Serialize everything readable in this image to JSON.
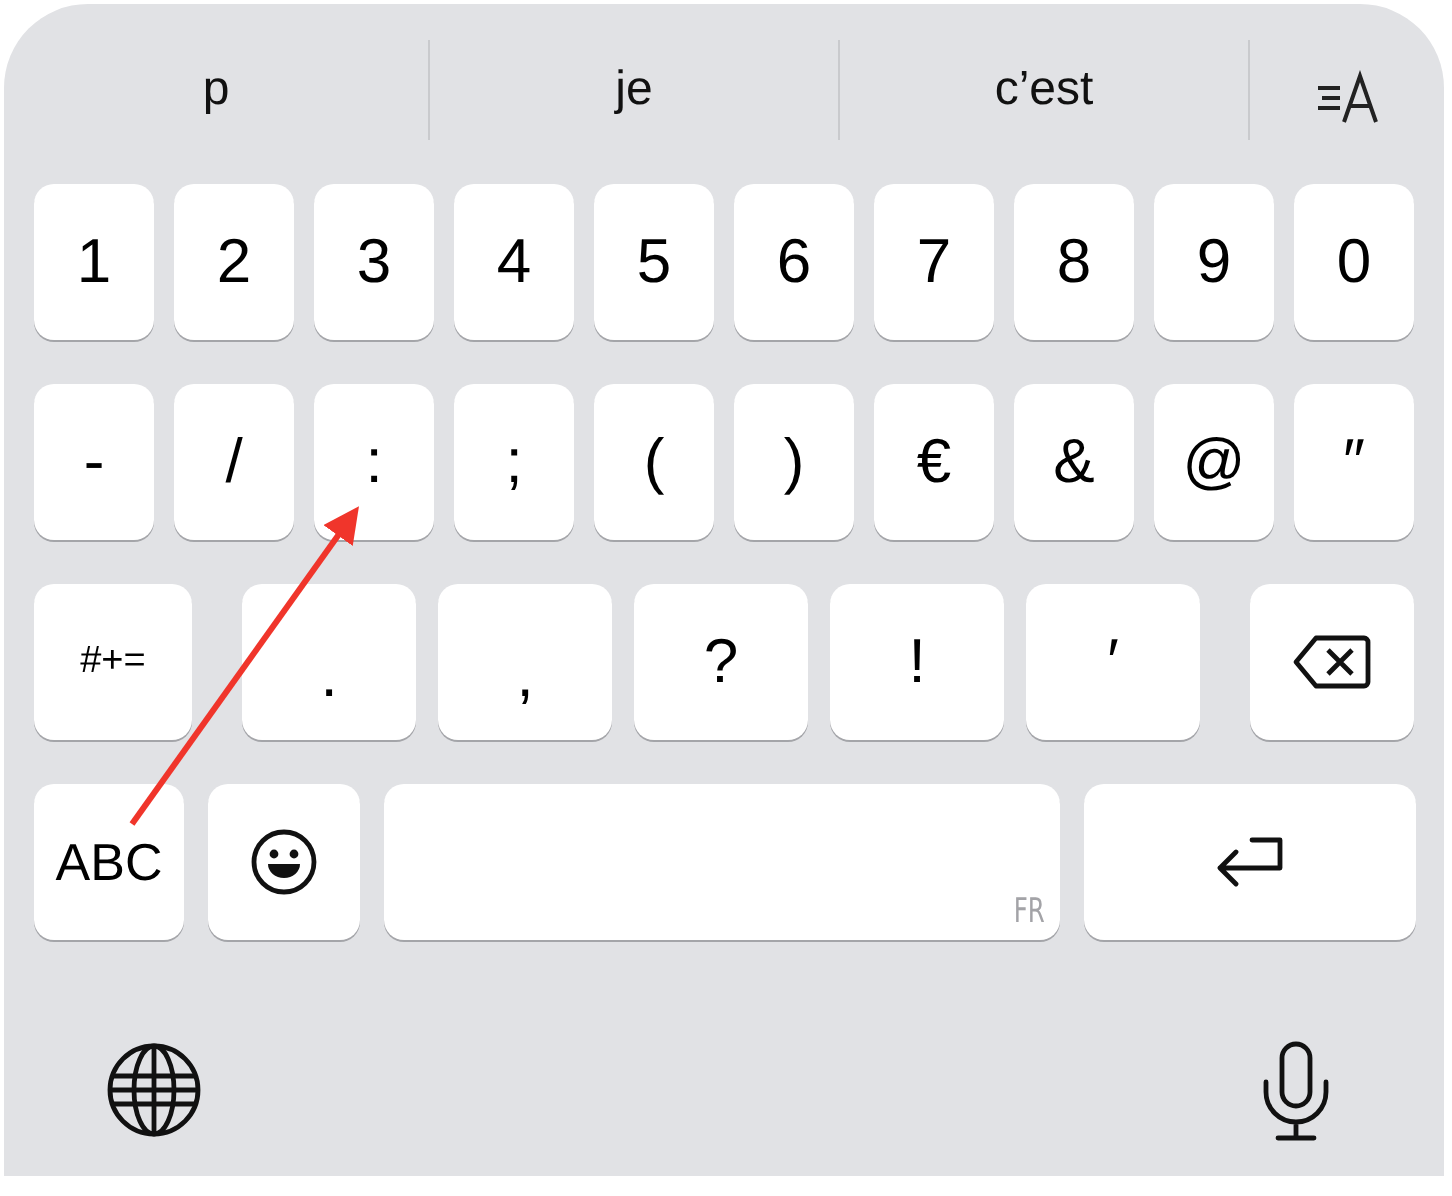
{
  "suggestions": [
    {
      "text": "p"
    },
    {
      "text": "je"
    },
    {
      "text": "c’est"
    }
  ],
  "rows": [
    [
      {
        "kind": "char",
        "label": "1"
      },
      {
        "kind": "char",
        "label": "2"
      },
      {
        "kind": "char",
        "label": "3"
      },
      {
        "kind": "char",
        "label": "4"
      },
      {
        "kind": "char",
        "label": "5"
      },
      {
        "kind": "char",
        "label": "6"
      },
      {
        "kind": "char",
        "label": "7"
      },
      {
        "kind": "char",
        "label": "8"
      },
      {
        "kind": "char",
        "label": "9"
      },
      {
        "kind": "char",
        "label": "0"
      }
    ],
    [
      {
        "kind": "char",
        "label": "-"
      },
      {
        "kind": "char",
        "label": "/"
      },
      {
        "kind": "char",
        "label": ":"
      },
      {
        "kind": "char",
        "label": ";"
      },
      {
        "kind": "char",
        "label": "("
      },
      {
        "kind": "char",
        "label": ")"
      },
      {
        "kind": "char",
        "label": "€"
      },
      {
        "kind": "char",
        "label": "&"
      },
      {
        "kind": "char",
        "label": "@"
      },
      {
        "kind": "char",
        "label": "″"
      }
    ],
    [
      {
        "kind": "shift",
        "label": "#+="
      },
      {
        "kind": "wide",
        "label": ".",
        "low": true
      },
      {
        "kind": "wide",
        "label": ",",
        "low": true
      },
      {
        "kind": "wide",
        "label": "?"
      },
      {
        "kind": "wide",
        "label": "!"
      },
      {
        "kind": "wide",
        "label": "′"
      },
      {
        "kind": "delete"
      }
    ],
    [
      {
        "kind": "abc",
        "label": "ABC"
      },
      {
        "kind": "emoji"
      },
      {
        "kind": "space",
        "language": "FR"
      },
      {
        "kind": "return"
      }
    ]
  ]
}
